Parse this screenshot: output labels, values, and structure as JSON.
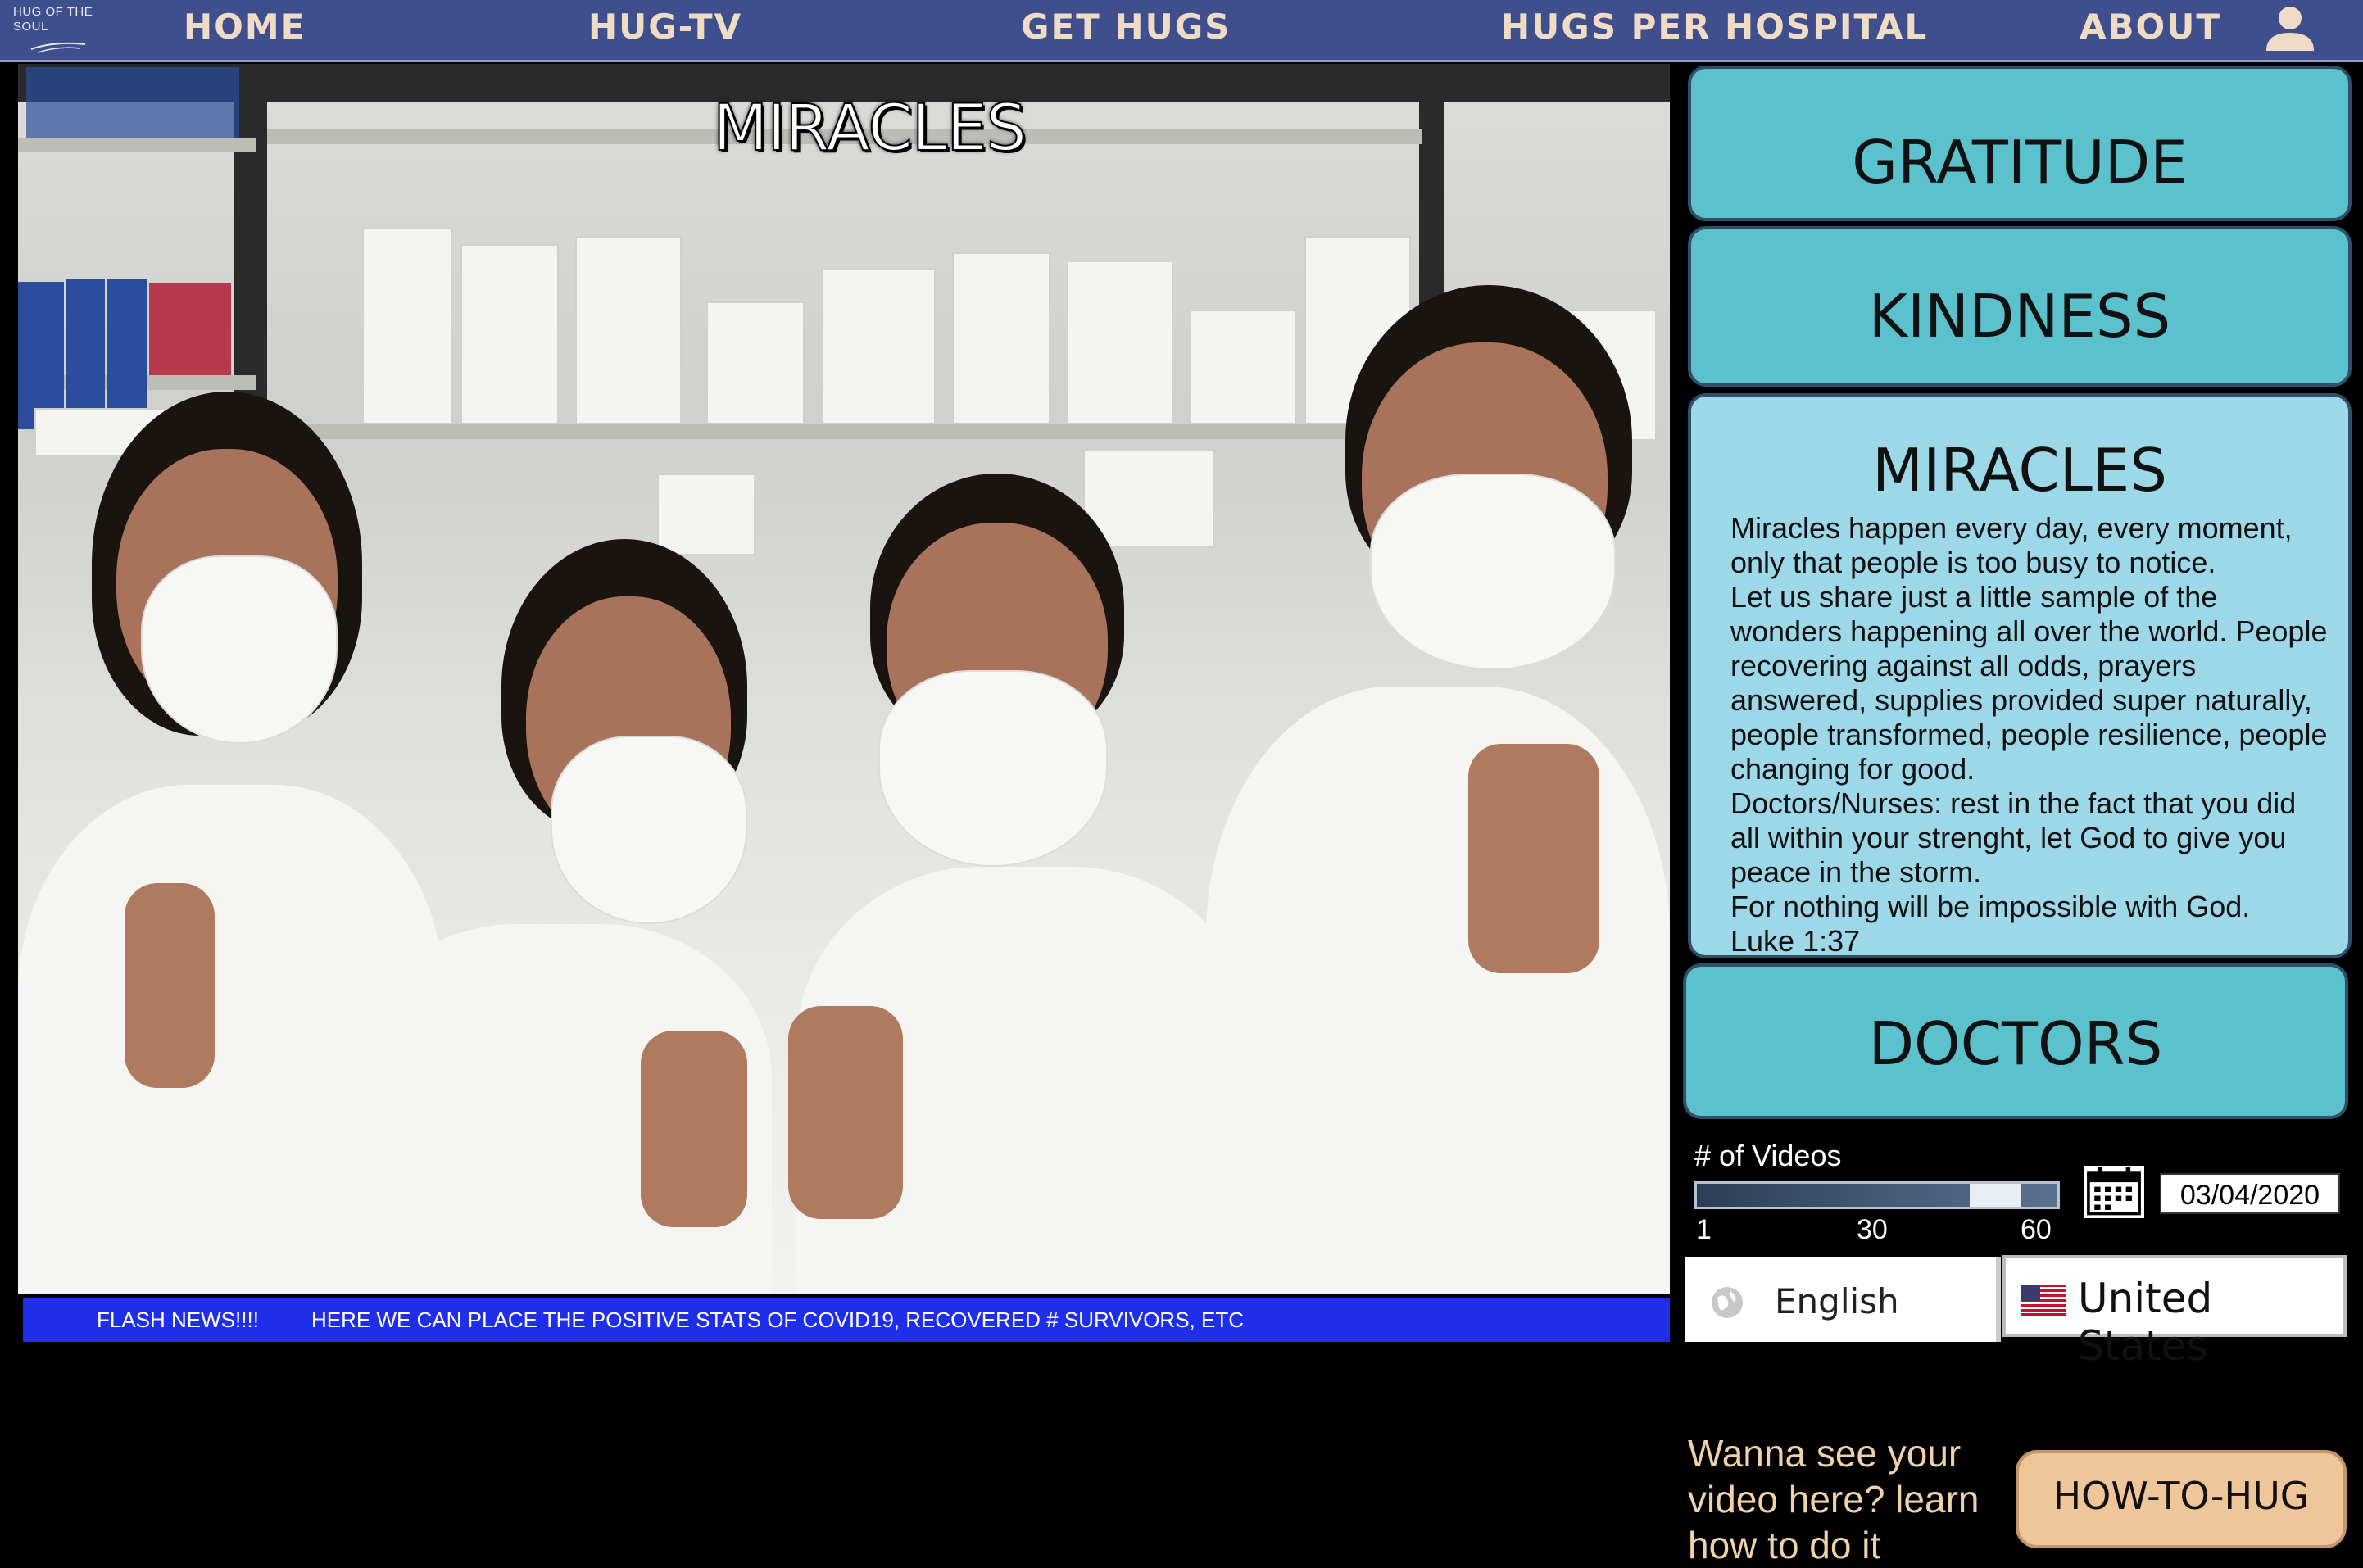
{
  "nav": {
    "logo_text": "HUG OF THE SOUL",
    "links": [
      "HOME",
      "HUG-TV",
      "GET HUGS",
      "HUGS PER HOSPITAL",
      "ABOUT"
    ]
  },
  "video": {
    "title": "MIRACLES"
  },
  "flash": {
    "label": "FLASH NEWS!!!!",
    "text": "HERE WE CAN PLACE THE POSITIVE STATS OF COVID19, RECOVERED # SURVIVORS, ETC"
  },
  "categories": {
    "gratitude": "GRATITUDE",
    "kindness": "KINDNESS",
    "miracles": {
      "title": "MIRACLES",
      "lines": [
        "Miracles happen every day, every moment,",
        "only that people is too busy to notice.",
        "Let us share just a little sample of the",
        "wonders happening all over the world. People",
        "recovering against all odds, prayers",
        "answered, supplies provided super naturally,",
        "people transformed, people resilience, people",
        "changing for good.",
        "Doctors/Nurses: rest in the fact that you did",
        "all within your strenght, let God to give you",
        "peace in the storm.",
        "For nothing will be impossible with God.",
        "Luke 1:37"
      ]
    },
    "doctors": "DOCTORS"
  },
  "controls": {
    "videos_label": "# of Videos",
    "slider_min": "1",
    "slider_mid": "30",
    "slider_max": "60",
    "slider_fraction": 0.88,
    "date": "03/04/2020",
    "language": "English",
    "country": "United States"
  },
  "promo": {
    "text": "Wanna see your video here? learn how to do it",
    "button": "HOW-TO-HUG"
  },
  "colors": {
    "nav_bg": "#3f4f8e",
    "nav_text": "#f0dcc4",
    "category": "#5ac1cd",
    "category_expanded": "#9dd8e8",
    "flash_bg": "#1f2ee8",
    "howto_bg": "#efc59a"
  }
}
